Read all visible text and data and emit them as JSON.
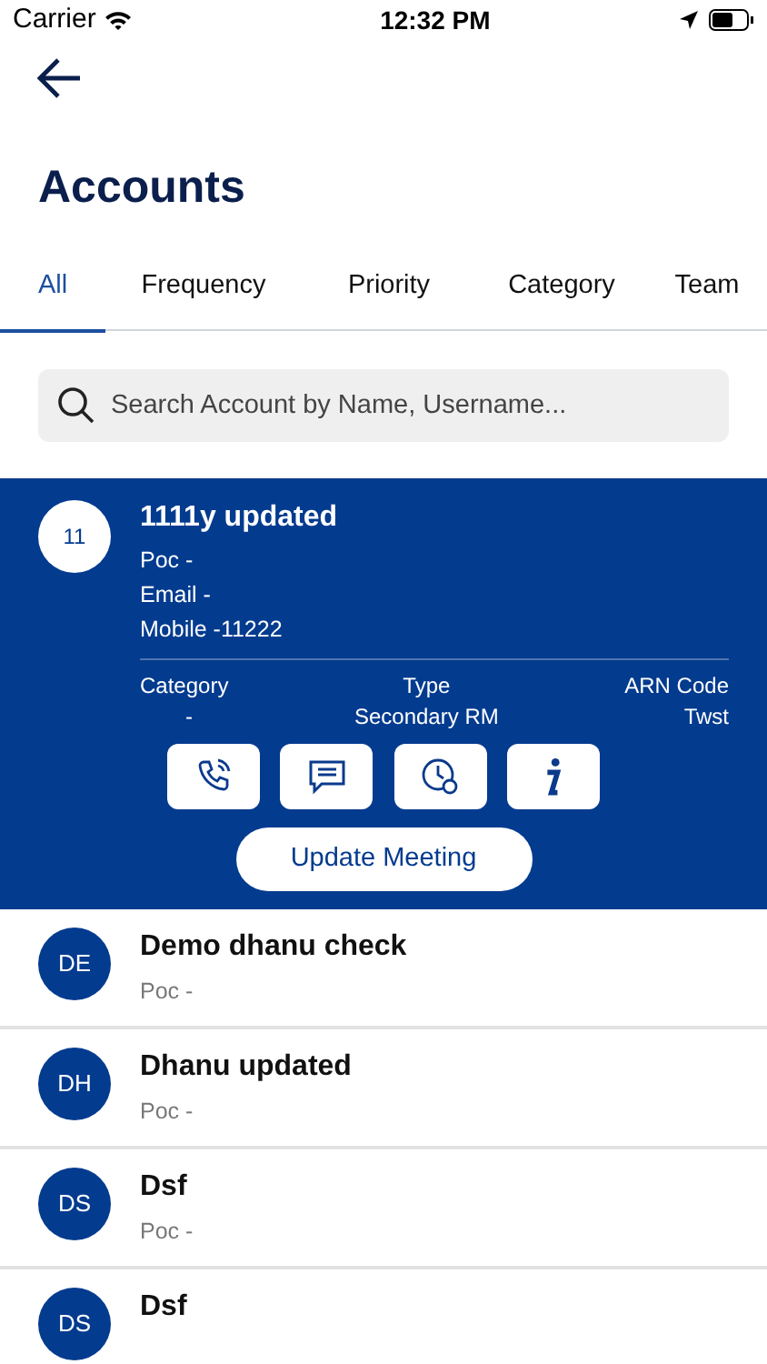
{
  "status_bar": {
    "carrier": "Carrier",
    "time": "12:32 PM"
  },
  "title": "Accounts",
  "tabs": [
    {
      "label": "All",
      "selected": true
    },
    {
      "label": "Frequency",
      "selected": false
    },
    {
      "label": "Priority",
      "selected": false
    },
    {
      "label": "Category",
      "selected": false
    },
    {
      "label": "Team",
      "selected": false
    }
  ],
  "search": {
    "placeholder": "Search Account by Name, Username..."
  },
  "accounts": [
    {
      "initials": "11",
      "name": "1111y updated",
      "expanded": true,
      "lines": [
        "Poc -",
        "Email -",
        "Mobile -11222"
      ],
      "details": [
        {
          "label": "Category",
          "value": "-"
        },
        {
          "label": "Type",
          "value": "Secondary RM"
        },
        {
          "label": "ARN Code",
          "value": "Twst"
        }
      ],
      "action": "Update Meeting"
    },
    {
      "initials": "DE",
      "name": "Demo dhanu check",
      "expanded": false,
      "lines": [
        "Poc -"
      ]
    },
    {
      "initials": "DH",
      "name": "Dhanu updated",
      "expanded": false,
      "lines": [
        "Poc -"
      ]
    },
    {
      "initials": "DS",
      "name": "Dsf",
      "expanded": false,
      "lines": [
        "Poc -"
      ]
    },
    {
      "initials": "DS",
      "name": "Dsf",
      "expanded": false
    }
  ]
}
